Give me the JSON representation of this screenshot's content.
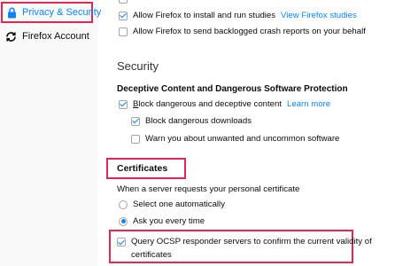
{
  "sidebar": {
    "items": [
      {
        "label": "Privacy & Security",
        "icon": "lock-icon",
        "active": true
      },
      {
        "label": "Firefox Account",
        "icon": "sync-icon",
        "active": false
      }
    ]
  },
  "data_collection": {
    "studies_label": "Allow Firefox to install and run studies",
    "studies_link": "View Firefox studies",
    "crash_reports_label": "Allow Firefox to send backlogged crash reports on your behalf"
  },
  "security": {
    "title": "Security",
    "deceptive_heading": "Deceptive Content and Dangerous Software Protection",
    "block_dangerous_label": "Block dangerous and deceptive content",
    "learn_more": "Learn more",
    "block_downloads_label": "Block dangerous downloads",
    "warn_unwanted_label": "Warn you about unwanted and uncommon software"
  },
  "certificates": {
    "heading": "Certificates",
    "prompt": "When a server requests your personal certificate",
    "select_auto_label": "Select one automatically",
    "ask_every_time_label": "Ask you every time",
    "ocsp_label_line1": "Query OCSP responder servers to confirm the current validity of",
    "ocsp_label_line2": "certificates"
  },
  "colors": {
    "accent": "#0a84ff",
    "highlight": "#e22850"
  }
}
